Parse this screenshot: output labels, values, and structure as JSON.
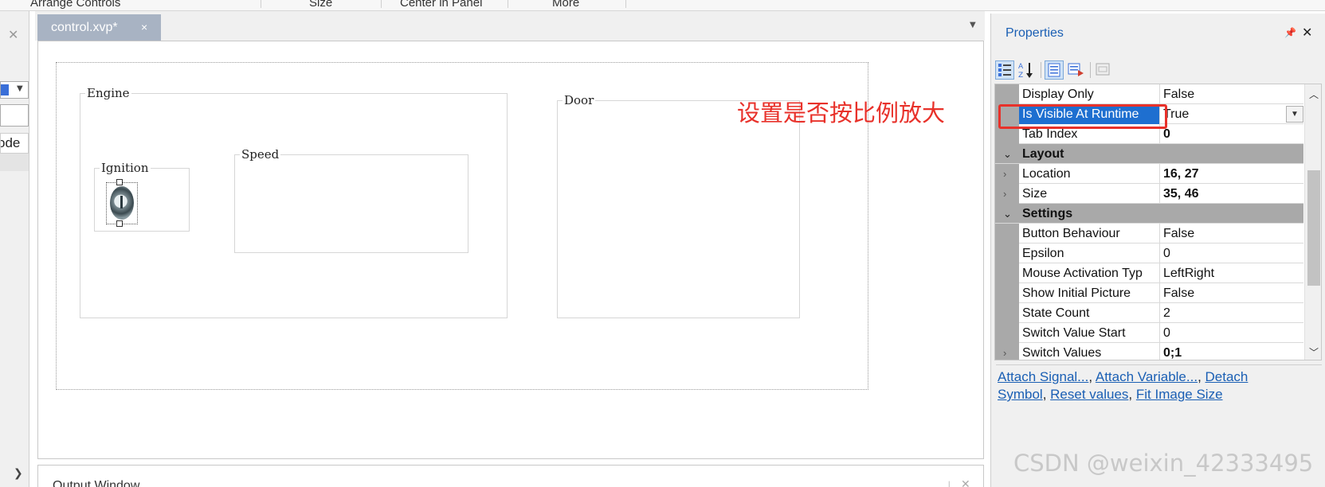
{
  "ribbon": {
    "items": [
      "Arrange Controls",
      "Size",
      "Center in Panel",
      "More"
    ]
  },
  "left_panel": {
    "tab_label": "ode"
  },
  "document": {
    "tab_title": "control.xvp*",
    "tab_close": "×"
  },
  "form": {
    "groups": {
      "engine": "Engine",
      "ignition": "Ignition",
      "speed": "Speed",
      "door": "Door"
    }
  },
  "output_window": {
    "title": "Output Window"
  },
  "annotation": {
    "text": "设置是否按比例放大",
    "color": "#e8312a"
  },
  "properties": {
    "title": "Properties",
    "rows": [
      {
        "name": "Display Only",
        "value": "False"
      },
      {
        "name": "Is Visible At Runtime",
        "value": "True"
      },
      {
        "name": "Tab Index",
        "value": "0"
      },
      {
        "name": "Layout",
        "value": ""
      },
      {
        "name": "Location",
        "value": "16, 27"
      },
      {
        "name": "Size",
        "value": "35, 46"
      },
      {
        "name": "Settings",
        "value": ""
      },
      {
        "name": "Button Behaviour",
        "value": "False"
      },
      {
        "name": "Epsilon",
        "value": "0"
      },
      {
        "name": "Mouse Activation Typ",
        "value": "LeftRight"
      },
      {
        "name": "Show Initial Picture",
        "value": "False"
      },
      {
        "name": "State Count",
        "value": "2"
      },
      {
        "name": "Switch Value Start",
        "value": "0"
      },
      {
        "name": "Switch Values",
        "value": "0;1"
      }
    ],
    "links": {
      "attach_signal": "Attach Signal...",
      "attach_variable": "Attach Variable...",
      "detach_symbol_1": "Detach",
      "detach_symbol_2": "Symbol",
      "reset_values": "Reset values",
      "fit_image_size": "Fit Image Size",
      "sep": ", "
    }
  },
  "watermark": "CSDN @weixin_42333495",
  "colors": {
    "accent_blue": "#1a5fb4",
    "selection": "#1e6fd0",
    "doc_tab": "#a8b3c3",
    "category": "#a9a9a9"
  }
}
